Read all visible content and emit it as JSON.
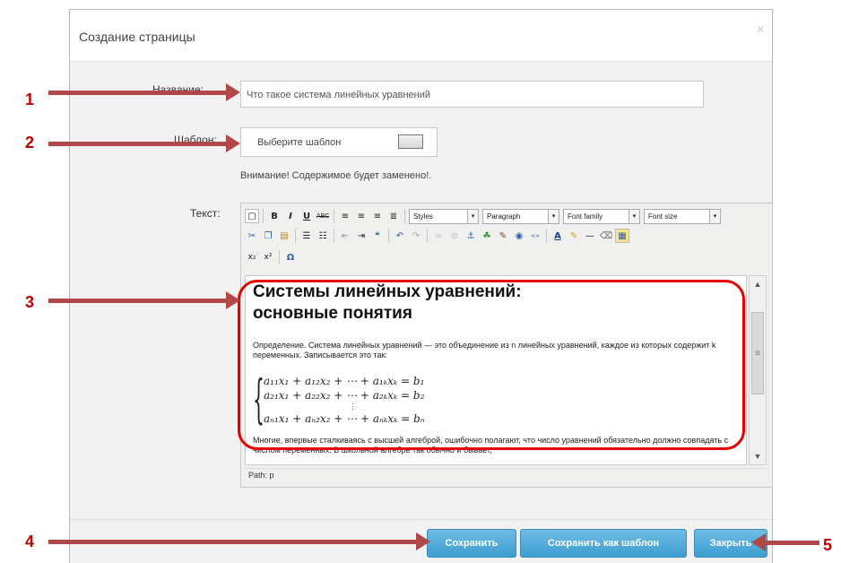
{
  "dialog": {
    "title": "Создание страницы",
    "close_glyph": "×"
  },
  "form": {
    "name_label": "Название:",
    "name_value": "Что такое система линейных уравнений",
    "template_label": "Шаблон:",
    "template_button_text": "Выберите шаблон",
    "warning": "Внимание! Содержимое будет заменено!.",
    "text_label": "Текст:"
  },
  "editor": {
    "toolbar_row1": {
      "bold": "B",
      "italic": "I",
      "underline": "U",
      "strike": "ABC",
      "styles": "Styles",
      "paragraph": "Paragraph",
      "font_family": "Font family",
      "font_size": "Font size"
    },
    "toolbar_row3": {
      "subscript": "x₂",
      "superscript": "x²",
      "omega": "Ω"
    },
    "heading_line1": "Системы линейных уравнений:",
    "heading_line2": "основные понятия",
    "paragraph": "Определение. Система линейных уравнений — это объединение из n линейных уравнений, каждое из которых содержит k переменных. Записывается это так:",
    "equations": [
      "a₁₁x₁ + a₁₂x₂ + ⋯ + a₁ₖxₖ = b₁",
      "a₂₁x₁ + a₂₂x₂ + ⋯ + a₂ₖxₖ = b₂",
      "aₙ₁x₁ + aₙ₂x₂ + ⋯ + aₙₖxₖ = bₙ"
    ],
    "after_text": "Многие, впервые сталкиваясь с высшей алгеброй, ошибочно полагают, что число уравнений обязательно должно совпадать с числом переменных. В школьной алгебре так обычно и бывает,",
    "path": "Path: p"
  },
  "buttons": {
    "save": "Сохранить",
    "save_as_template": "Сохранить как шаблон",
    "close": "Закрыть"
  },
  "annotations": {
    "n1": "1",
    "n2": "2",
    "n3": "3",
    "n4": "4",
    "n5": "5",
    "arrow_color": "#b0484a",
    "highlight_color": "#e60000"
  },
  "colors": {
    "button_bg": "#4aa8d8",
    "dialog_border": "#b9b0cf"
  }
}
